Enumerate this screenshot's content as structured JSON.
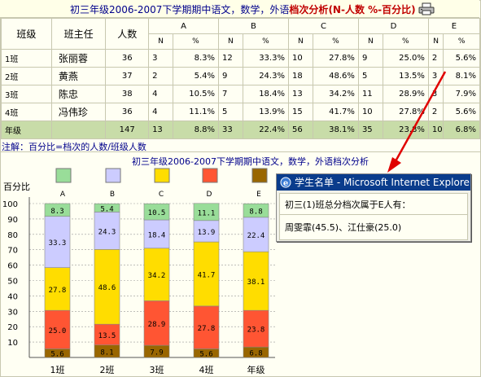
{
  "header": {
    "title_main": "初三年级2006-2007下学期期中语文，数学，外语",
    "title_kw": "档次分析",
    "title_legend": "(N-人数 %-百分比)",
    "print_icon": "printer-icon"
  },
  "table": {
    "col_class": "班级",
    "col_teacher": "班主任",
    "col_count": "人数",
    "groups": [
      "A",
      "B",
      "C",
      "D",
      "E"
    ],
    "sub_n": "N",
    "sub_pct": "%",
    "rows": [
      {
        "cls": "1班",
        "teacher": "张丽蓉",
        "count": "36",
        "cells": [
          [
            "3",
            "8.3%"
          ],
          [
            "12",
            "33.3%"
          ],
          [
            "10",
            "27.8%"
          ],
          [
            "9",
            "25.0%"
          ],
          [
            "2",
            "5.6%"
          ]
        ]
      },
      {
        "cls": "2班",
        "teacher": "黄燕",
        "count": "37",
        "cells": [
          [
            "2",
            "5.4%"
          ],
          [
            "9",
            "24.3%"
          ],
          [
            "18",
            "48.6%"
          ],
          [
            "5",
            "13.5%"
          ],
          [
            "3",
            "8.1%"
          ]
        ]
      },
      {
        "cls": "3班",
        "teacher": "陈忠",
        "count": "38",
        "cells": [
          [
            "4",
            "10.5%"
          ],
          [
            "7",
            "18.4%"
          ],
          [
            "13",
            "34.2%"
          ],
          [
            "11",
            "28.9%"
          ],
          [
            "3",
            "7.9%"
          ]
        ]
      },
      {
        "cls": "4班",
        "teacher": "冯伟珍",
        "count": "36",
        "cells": [
          [
            "4",
            "11.1%"
          ],
          [
            "5",
            "13.9%"
          ],
          [
            "15",
            "41.7%"
          ],
          [
            "10",
            "27.8%"
          ],
          [
            "2",
            "5.6%"
          ]
        ]
      }
    ],
    "total": {
      "cls": "年级",
      "teacher": "",
      "count": "147",
      "cells": [
        [
          "13",
          "8.8%"
        ],
        [
          "33",
          "22.4%"
        ],
        [
          "56",
          "38.1%"
        ],
        [
          "35",
          "23.8%"
        ],
        [
          "10",
          "6.8%"
        ]
      ]
    }
  },
  "note": "注解：百分比=档次的人数/班级人数",
  "chart_title": "初三年级2006-2007下学期期中语文，数学，外语档次分析",
  "chart_data": {
    "type": "bar",
    "stacked": true,
    "title": "初三年级2006-2007下学期期中语文，数学，外语档次分析",
    "ylabel": "百分比",
    "ylim": [
      0,
      100
    ],
    "yticks": [
      10,
      20,
      30,
      40,
      50,
      60,
      70,
      80,
      90,
      100
    ],
    "categories": [
      "1班",
      "2班",
      "3班",
      "4班",
      "年级"
    ],
    "legend": [
      "A",
      "B",
      "C",
      "D",
      "E"
    ],
    "series": [
      {
        "name": "E",
        "color": "#996600",
        "values": [
          5.6,
          8.1,
          7.9,
          5.6,
          6.8
        ]
      },
      {
        "name": "D",
        "color": "#FF5533",
        "values": [
          25.0,
          13.5,
          28.9,
          27.8,
          23.8
        ]
      },
      {
        "name": "C",
        "color": "#FFDD00",
        "values": [
          27.8,
          48.6,
          34.2,
          41.7,
          38.1
        ]
      },
      {
        "name": "B",
        "color": "#CCCCFF",
        "values": [
          33.3,
          24.3,
          18.4,
          13.9,
          22.4
        ]
      },
      {
        "name": "A",
        "color": "#99DD99",
        "values": [
          8.3,
          5.4,
          10.5,
          11.1,
          8.8
        ]
      }
    ],
    "legend_colors": [
      "#99DD99",
      "#CCCCFF",
      "#FFDD00",
      "#FF5533",
      "#996600"
    ]
  },
  "popup": {
    "title": "学生名单 - Microsoft Internet Explorer",
    "line1": "初三(1)班总分档次属于E人有：",
    "line2": "周雯霏(45.5)、江仕豪(25.0)"
  },
  "colors": {
    "arrow": "#E00000",
    "total_row": "#C8DCA8",
    "title_bar": "#0A3C8C"
  }
}
